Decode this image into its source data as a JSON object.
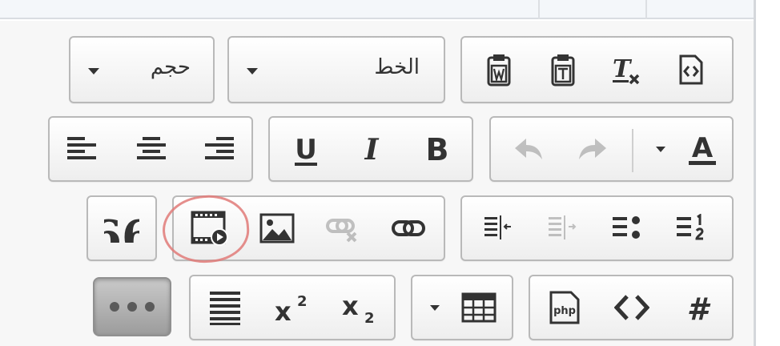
{
  "dropdowns": {
    "size_label": "حجم",
    "font_label": "الخط"
  },
  "icons": {
    "paste_from_word": "paste-word-icon",
    "paste_text": "paste-text-icon",
    "remove_format": "remove-format-icon",
    "source": "source-icon",
    "align_left": "align-left-icon",
    "align_center": "align-center-icon",
    "align_right": "align-right-icon",
    "underline": "underline-icon",
    "italic": "italic-icon",
    "bold": "bold-icon",
    "undo": "undo-icon",
    "redo": "redo-icon",
    "text_color": "text-color-icon",
    "blockquote": "blockquote-icon",
    "video": "video-icon",
    "image": "image-icon",
    "unlink": "unlink-icon",
    "link": "link-icon",
    "indent": "indent-icon",
    "outdent": "outdent-icon",
    "bulleted_list": "bulleted-list-icon",
    "numbered_list": "numbered-list-icon",
    "more": "more-icon",
    "justify": "justify-icon",
    "superscript": "superscript-icon",
    "subscript": "subscript-icon",
    "table": "table-icon",
    "php": "php-icon",
    "code": "code-icon",
    "hash": "hash-icon"
  },
  "glyphs": {
    "underline": "U",
    "italic": "I",
    "bold": "B",
    "text_color": "A",
    "blockquote": "66",
    "php": "php",
    "superscript_base": "x",
    "superscript_exp": "2",
    "subscript_base": "x",
    "subscript_exp": "2",
    "hash": "#"
  },
  "colors": {
    "toolbar_bg": "#f7f7f7",
    "button_border": "#b9b9b9",
    "icon": "#333333",
    "disabled_icon": "#c7c7c7",
    "annotation": "#e07a78"
  }
}
